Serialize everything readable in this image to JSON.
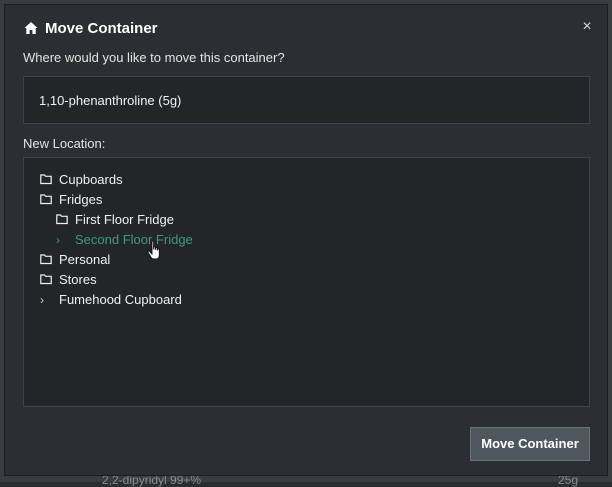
{
  "background": {
    "row_left_text": "2,2-dipyridyl 99+%",
    "row_right_text": "25g"
  },
  "dialog": {
    "title": "Move Container",
    "title_icon": "home-icon",
    "close_label": "×",
    "question": "Where would you like to move this container?",
    "container_name": "1,10-phenanthroline (5g)",
    "new_location_label": "New Location:",
    "tree": [
      {
        "label": "Cupboards",
        "icon": "folder-icon",
        "active": false
      },
      {
        "label": "Fridges",
        "icon": "folder-icon",
        "active": false
      },
      {
        "label": "First Floor Fridge",
        "icon": "folder-icon",
        "active": false
      },
      {
        "label": "Second Floor Fridge",
        "icon": "chevron-right-icon",
        "active": true
      },
      {
        "label": "Personal",
        "icon": "folder-icon",
        "active": false
      },
      {
        "label": "Stores",
        "icon": "folder-icon",
        "active": false
      },
      {
        "label": "Fumehood Cupboard",
        "icon": "chevron-right-icon",
        "active": false
      }
    ],
    "submit_label": "Move Container"
  },
  "colors": {
    "accent_active": "#3d9a7a",
    "dialog_bg": "#2b2e32",
    "panel_bg": "#232628",
    "button_bg": "#4f575e"
  }
}
